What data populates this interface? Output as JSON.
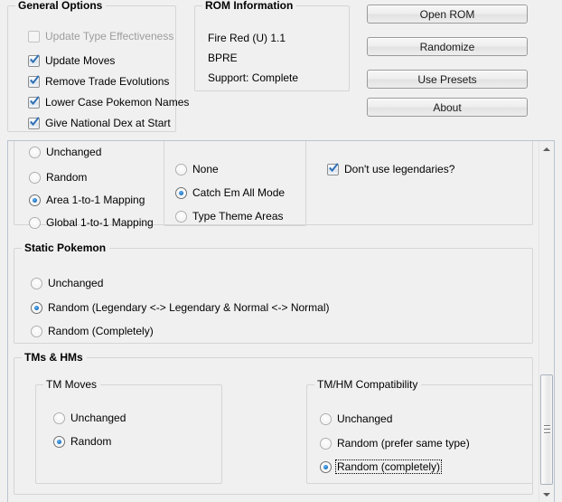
{
  "general_options": {
    "title": "General Options",
    "checkboxes": [
      {
        "label": "Update Type Effectiveness",
        "checked": false,
        "enabled": false
      },
      {
        "label": "Update Moves",
        "checked": true,
        "enabled": true
      },
      {
        "label": "Remove Trade Evolutions",
        "checked": true,
        "enabled": true
      },
      {
        "label": "Lower Case Pokemon Names",
        "checked": true,
        "enabled": true
      },
      {
        "label": "Give National Dex at Start",
        "checked": true,
        "enabled": true
      }
    ]
  },
  "rom_information": {
    "title": "ROM Information",
    "lines": [
      "Fire Red (U) 1.1",
      "BPRE",
      "Support: Complete"
    ]
  },
  "actions": {
    "open_rom": "Open ROM",
    "randomize": "Randomize",
    "use_presets": "Use Presets",
    "about": "About"
  },
  "wild_pokemon": {
    "mapping_options": [
      {
        "label": "Unchanged",
        "checked": false
      },
      {
        "label": "Random",
        "checked": false
      },
      {
        "label": "Area 1-to-1 Mapping",
        "checked": true
      },
      {
        "label": "Global 1-to-1 Mapping",
        "checked": false
      }
    ],
    "mode_options": [
      {
        "label": "None",
        "checked": false
      },
      {
        "label": "Catch Em All Mode",
        "checked": true
      },
      {
        "label": "Type Theme Areas",
        "checked": false
      }
    ],
    "legendaries": {
      "label": "Don't use legendaries?",
      "checked": true
    }
  },
  "static_pokemon": {
    "title": "Static Pokemon",
    "options": [
      {
        "label": "Unchanged",
        "checked": false
      },
      {
        "label": "Random (Legendary <-> Legendary & Normal <-> Normal)",
        "checked": true
      },
      {
        "label": "Random (Completely)",
        "checked": false
      }
    ]
  },
  "tms_hms": {
    "title": "TMs & HMs",
    "tm_moves": {
      "title": "TM Moves",
      "options": [
        {
          "label": "Unchanged",
          "checked": false
        },
        {
          "label": "Random",
          "checked": true
        }
      ]
    },
    "compatibility": {
      "title": "TM/HM Compatibility",
      "options": [
        {
          "label": "Unchanged",
          "checked": false
        },
        {
          "label": "Random (prefer same type)",
          "checked": false
        },
        {
          "label": "Random (completely)",
          "checked": true,
          "focused": true
        }
      ]
    }
  },
  "scrollbar": {
    "up_arrow": "scroll-up-arrow",
    "down_arrow": "scroll-down-arrow"
  },
  "colors": {
    "background": "#f0f0f0",
    "accent_blue": "#1f78c8",
    "border": "#d5d5d5",
    "disabled_text": "#9d9d9d"
  }
}
